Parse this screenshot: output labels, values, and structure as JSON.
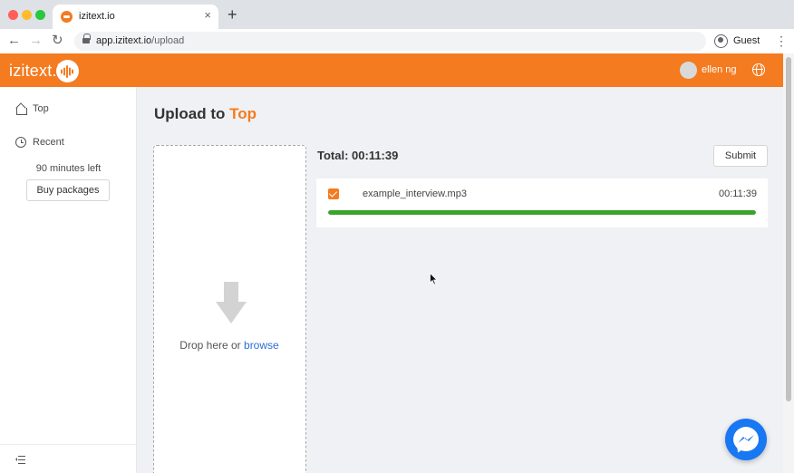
{
  "browser": {
    "tab_title": "izitext.io",
    "tab_close": "×",
    "new_tab": "+",
    "url_host": "app.izitext.io",
    "url_path": "/upload",
    "profile_label": "Guest",
    "back": "←",
    "forward": "→",
    "reload": "↻",
    "menu": "⋮"
  },
  "app": {
    "brand": "izitext.i",
    "user_name": "ellen ng",
    "brand_color": "#f47b20"
  },
  "sidebar": {
    "items": [
      {
        "label": "Top",
        "icon": "home-icon"
      },
      {
        "label": "Recent",
        "icon": "clock-icon"
      }
    ],
    "minutes_left": "90 minutes left",
    "buy_label": "Buy packages"
  },
  "main": {
    "title_prefix": "Upload to",
    "title_target": "Top",
    "drop_text": "Drop here or",
    "browse_label": "browse",
    "total_label": "Total: 00:11:39",
    "submit_label": "Submit",
    "files": [
      {
        "name": "example_interview.mp3",
        "duration": "00:11:39",
        "checked": true,
        "progress": 1.0
      }
    ],
    "progress_color": "#3aa32b"
  }
}
